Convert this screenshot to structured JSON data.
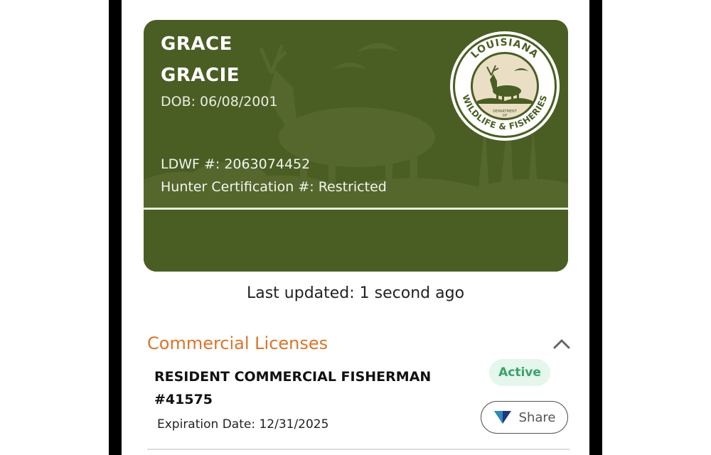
{
  "card": {
    "first_name": "GRACE",
    "last_name": "GRACIE",
    "dob": "DOB: 06/08/2001",
    "ldwf": "LDWF #: 2063074452",
    "hunter_cert": "Hunter Certification #: Restricted",
    "seal": {
      "top_text": "LOUISIANA",
      "bottom_text": "WILDLIFE & FISHERIES",
      "center_line1": "DEPARTMENT",
      "center_line2": "OF"
    },
    "colors": {
      "card_green": "#4a5e24",
      "seal_cream": "#eadfc4",
      "divider": "#e9eee2"
    }
  },
  "status": {
    "last_updated": "Last updated: 1 second ago"
  },
  "commercial": {
    "section_title": "Commercial Licenses",
    "accent_color": "#d9752a",
    "license": {
      "name": "RESIDENT COMMERCIAL FISHERMAN #41575",
      "expiration": "Expiration Date: 12/31/2025",
      "status": "Active",
      "share_label": "Share"
    }
  },
  "icons": {
    "collapse": "chevron-up-icon",
    "share": "share-triangle-icon"
  }
}
